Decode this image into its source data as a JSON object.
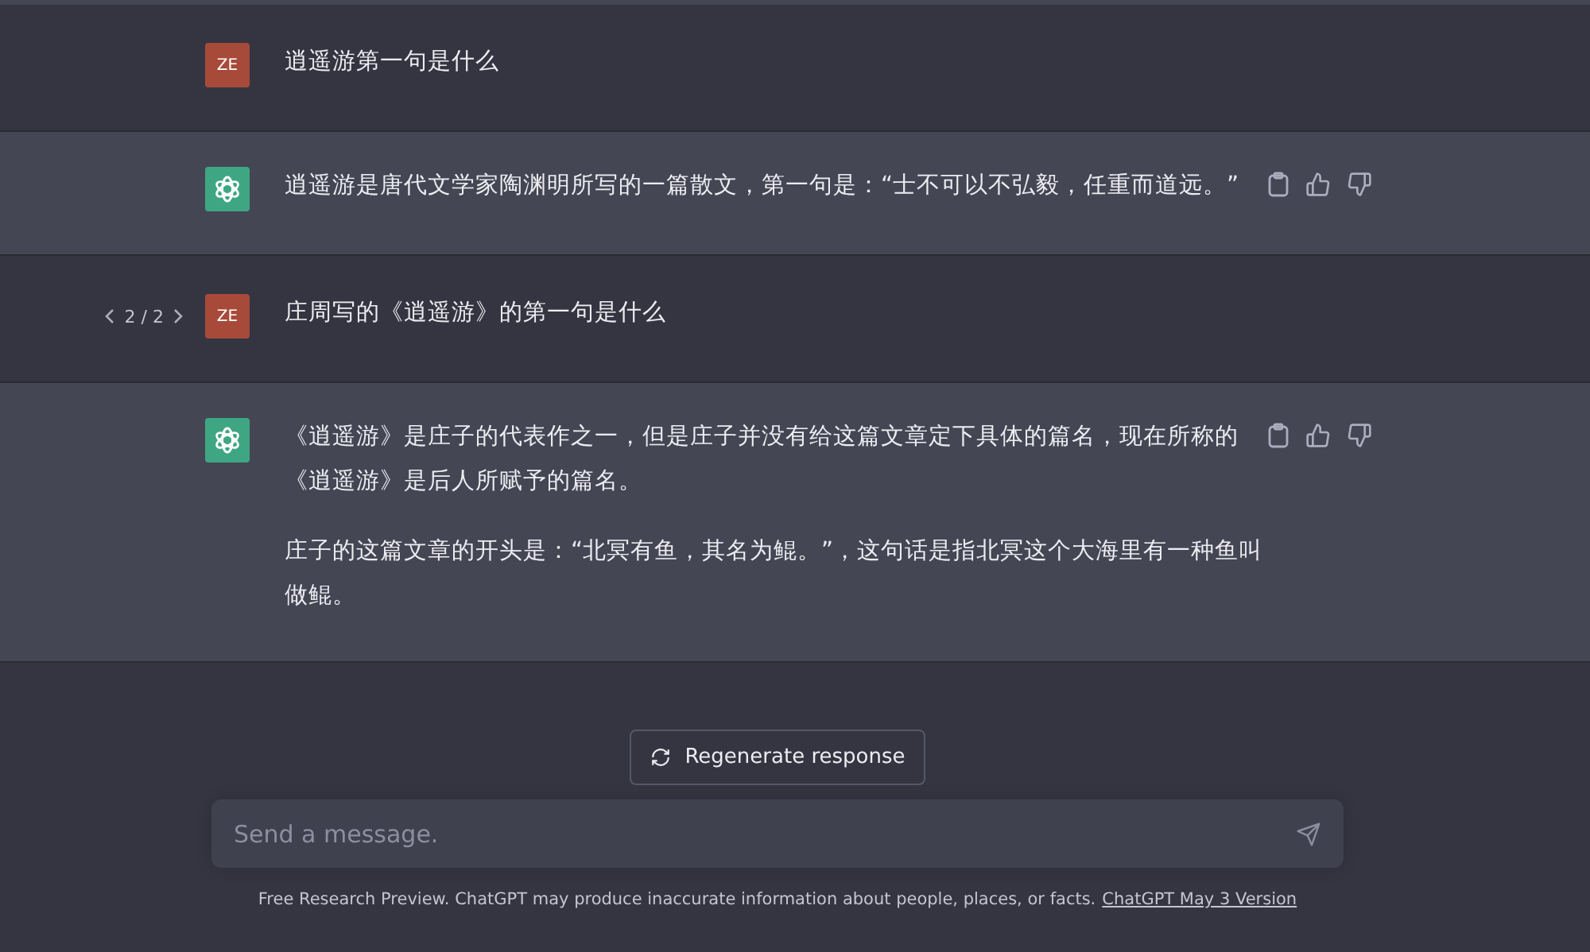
{
  "messages": [
    {
      "kind": "user",
      "avatar": "ZE",
      "paragraphs": [
        [
          "逍遥游第一句是什么"
        ]
      ]
    },
    {
      "kind": "assistant",
      "paragraphs": [
        [
          "逍遥游是唐代文学家陶渊明所写的一篇散文，第一句是：“士不可以不弘毅，任重而道远。”"
        ]
      ]
    },
    {
      "kind": "user",
      "avatar": "ZE",
      "pager": "2 / 2",
      "paragraphs": [
        [
          "庄周写的《逍遥游》的第一句是什么"
        ]
      ]
    },
    {
      "kind": "assistant",
      "paragraphs": [
        [
          "《逍遥游》是庄子的代表作之一，但是庄子并没有给这篇文章定下具体的篇名，现在所称的",
          "《逍遥游》是后人所赋予的篇名。"
        ],
        [
          "庄子的这篇文章的开头是：“北冥有鱼，其名为鲲。”，这句话是指北冥这个大海里有一种鱼叫",
          "做鲲。"
        ]
      ]
    }
  ],
  "regenerate_button": "Regenerate response",
  "composer": {
    "placeholder": "Send a message."
  },
  "footer": {
    "text": "Free Research Preview. ChatGPT may produce inaccurate information about people, places, or facts.",
    "link": "ChatGPT May 3 Version"
  }
}
